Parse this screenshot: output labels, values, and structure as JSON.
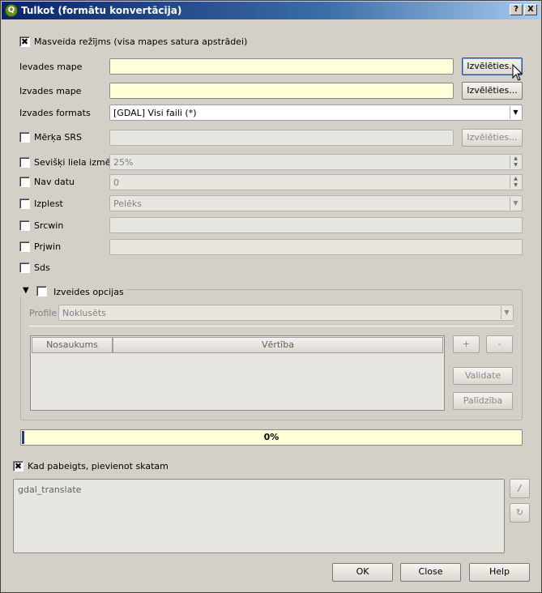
{
  "window": {
    "title": "Tulkot (formātu konvertācija)",
    "help_glyph": "?",
    "close_glyph": "X"
  },
  "batch_mode": {
    "label": "Masveida režījms (visa mapes satura apstrādei)",
    "checked": true
  },
  "input_dir": {
    "label": "Ievades mape",
    "value": "",
    "button": "Izvēlēties..."
  },
  "output_dir": {
    "label": "Izvades mape",
    "value": "",
    "button": "Izvēlēties..."
  },
  "output_format": {
    "label": "Izvades formats",
    "value": "[GDAL] Visi faili (*)"
  },
  "target_srs": {
    "label": "Mērķa SRS",
    "value": "",
    "button": "Izvēlēties...",
    "checked": false
  },
  "outsize": {
    "label": "Sevišķi liela izmēr",
    "value": "25%",
    "checked": false
  },
  "nodata": {
    "label": "Nav datu",
    "value": "0",
    "checked": false
  },
  "expand": {
    "label": "Izplest",
    "value": "Pelēks",
    "checked": false
  },
  "srcwin": {
    "label": "Srcwin",
    "value": "",
    "checked": false
  },
  "prjwin": {
    "label": "Prjwin",
    "value": "",
    "checked": false
  },
  "sds": {
    "label": "Sds",
    "checked": false
  },
  "creation_options": {
    "label": "Izveides opcijas",
    "checked": false,
    "profile_label": "Profile",
    "profile_value": "Noklusēts",
    "columns": [
      "Nosaukums",
      "Vērtība"
    ],
    "add_glyph": "+",
    "remove_glyph": "-",
    "validate_label": "Validate",
    "help_label": "Palīdzība"
  },
  "progress": {
    "text": "0%",
    "value": 0
  },
  "load_into_canvas": {
    "label": "Kad pabeigts, pievienot skatam",
    "checked": true
  },
  "command": {
    "text": "gdal_translate"
  },
  "footer": {
    "ok": "OK",
    "close": "Close",
    "help": "Help"
  }
}
